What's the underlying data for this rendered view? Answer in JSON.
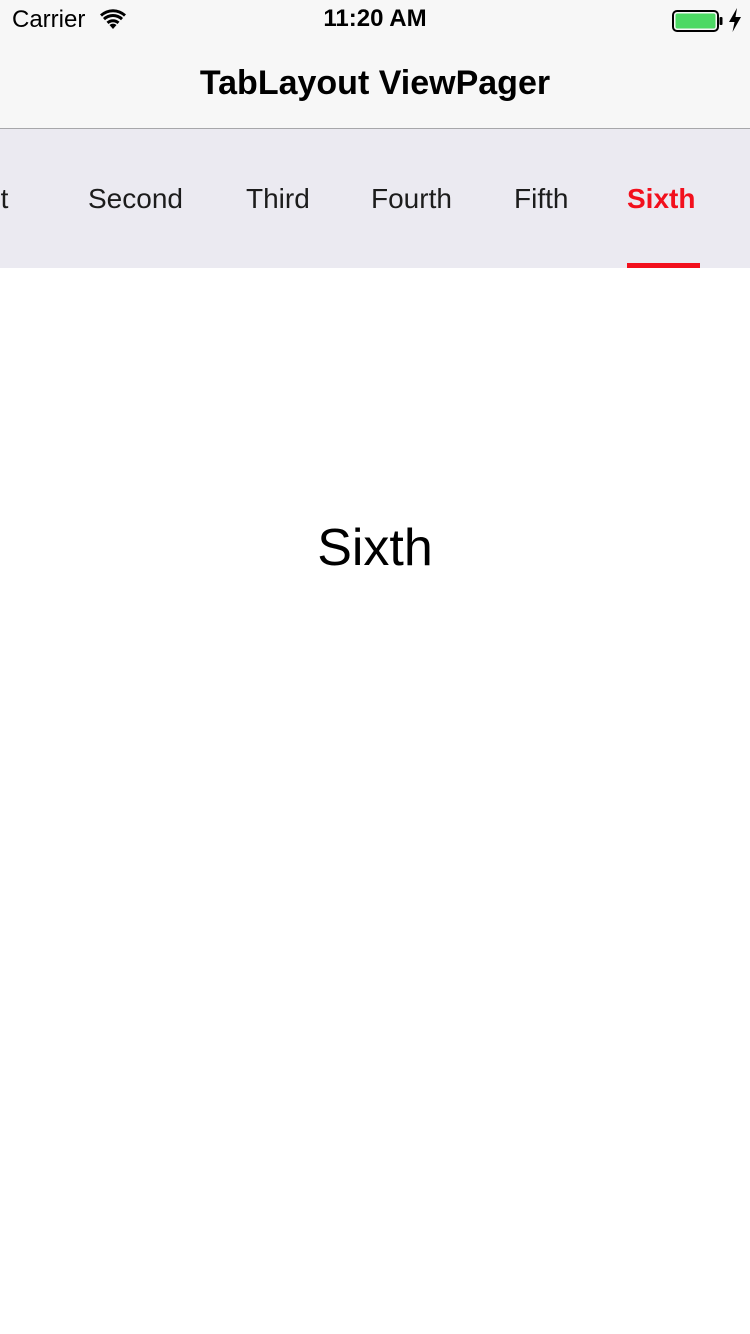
{
  "status_bar": {
    "carrier": "Carrier",
    "time": "11:20 AM",
    "wifi_icon": "wifi-icon",
    "battery_icon": "battery-icon",
    "charging_icon": "bolt-icon",
    "battery_color": "#4cd964"
  },
  "nav": {
    "title": "TabLayout ViewPager"
  },
  "tabs": {
    "items": [
      {
        "label": "First"
      },
      {
        "label": "Second"
      },
      {
        "label": "Third"
      },
      {
        "label": "Fourth"
      },
      {
        "label": "Fifth"
      },
      {
        "label": "Sixth"
      }
    ],
    "selected": "Sixth",
    "active_color": "#f2101d",
    "strip_color": "#ebeaf1"
  },
  "page": {
    "label": "Sixth"
  }
}
